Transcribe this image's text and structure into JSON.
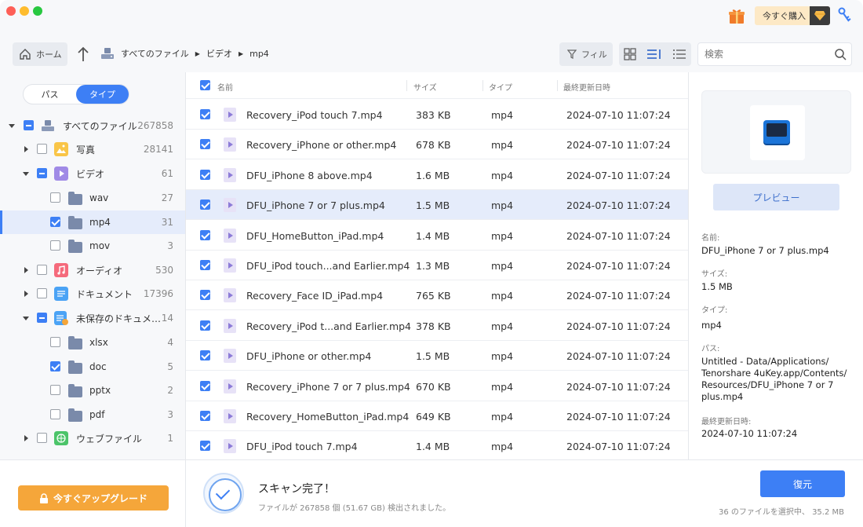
{
  "titlebar": {
    "buy_label": "今すぐ購入"
  },
  "toolbar": {
    "home_label": "ホーム",
    "breadcrumb": [
      "すべてのファイル",
      "ビデオ",
      "mp4"
    ],
    "filter_label": "フィル",
    "search_placeholder": "検索"
  },
  "sidebar": {
    "tabs": [
      "パス",
      "タイプ"
    ],
    "active_tab": "タイプ",
    "tree": [
      {
        "label": "すべてのファイル",
        "count": "267858"
      },
      {
        "label": "写真",
        "count": "28141"
      },
      {
        "label": "ビデオ",
        "count": "61"
      },
      {
        "label": "wav",
        "count": "27"
      },
      {
        "label": "mp4",
        "count": "31"
      },
      {
        "label": "mov",
        "count": "3"
      },
      {
        "label": "オーディオ",
        "count": "530"
      },
      {
        "label": "ドキュメント",
        "count": "17396"
      },
      {
        "label": "未保存のドキュメ…",
        "count": "14"
      },
      {
        "label": "xlsx",
        "count": "4"
      },
      {
        "label": "doc",
        "count": "5"
      },
      {
        "label": "pptx",
        "count": "2"
      },
      {
        "label": "pdf",
        "count": "3"
      },
      {
        "label": "ウェブファイル",
        "count": "1"
      }
    ],
    "upgrade_label": "今すぐアップグレード"
  },
  "table": {
    "columns": [
      "名前",
      "サイズ",
      "タイプ",
      "最終更新日時"
    ],
    "rows": [
      {
        "name": "Recovery_iPod touch 7.mp4",
        "size": "383 KB",
        "type": "mp4",
        "date": "2024-07-10 11:07:24"
      },
      {
        "name": "Recovery_iPhone or other.mp4",
        "size": "678 KB",
        "type": "mp4",
        "date": "2024-07-10 11:07:24"
      },
      {
        "name": "DFU_iPhone 8 above.mp4",
        "size": "1.6 MB",
        "type": "mp4",
        "date": "2024-07-10 11:07:24"
      },
      {
        "name": "DFU_iPhone 7 or 7 plus.mp4",
        "size": "1.5 MB",
        "type": "mp4",
        "date": "2024-07-10 11:07:24"
      },
      {
        "name": "DFU_HomeButton_iPad.mp4",
        "size": "1.4 MB",
        "type": "mp4",
        "date": "2024-07-10 11:07:24"
      },
      {
        "name": "DFU_iPod touch...and Earlier.mp4",
        "size": "1.3 MB",
        "type": "mp4",
        "date": "2024-07-10 11:07:24"
      },
      {
        "name": "Recovery_Face ID_iPad.mp4",
        "size": "765 KB",
        "type": "mp4",
        "date": "2024-07-10 11:07:24"
      },
      {
        "name": "Recovery_iPod t...and Earlier.mp4",
        "size": "378 KB",
        "type": "mp4",
        "date": "2024-07-10 11:07:24"
      },
      {
        "name": "DFU_iPhone or other.mp4",
        "size": "1.5 MB",
        "type": "mp4",
        "date": "2024-07-10 11:07:24"
      },
      {
        "name": "Recovery_iPhone 7 or 7 plus.mp4",
        "size": "670 KB",
        "type": "mp4",
        "date": "2024-07-10 11:07:24"
      },
      {
        "name": "Recovery_HomeButton_iPad.mp4",
        "size": "649 KB",
        "type": "mp4",
        "date": "2024-07-10 11:07:24"
      },
      {
        "name": "DFU_iPod touch 7.mp4",
        "size": "1.4 MB",
        "type": "mp4",
        "date": "2024-07-10 11:07:24"
      }
    ]
  },
  "details": {
    "preview_label": "プレビュー",
    "name_label": "名前:",
    "name_value": "DFU_iPhone 7 or 7 plus.mp4",
    "size_label": "サイズ:",
    "size_value": "1.5 MB",
    "type_label": "タイプ:",
    "type_value": "mp4",
    "path_label": "パス:",
    "path_value": "Untitled - Data/Applications/ Tenorshare 4uKey.app/Contents/ Resources/DFU_iPhone 7 or 7 plus.mp4",
    "date_label": "最終更新日時:",
    "date_value": "2024-07-10 11:07:24"
  },
  "status": {
    "title": "スキャン完了！",
    "subtitle": "ファイルが 267858 個 (51.67 GB) 検出されました。",
    "restore_label": "復元",
    "selected_info": "36 のファイルを選択中、 35.2 MB"
  },
  "colors": {
    "accent": "#3d7ff5",
    "upgrade": "#f5a63a"
  }
}
